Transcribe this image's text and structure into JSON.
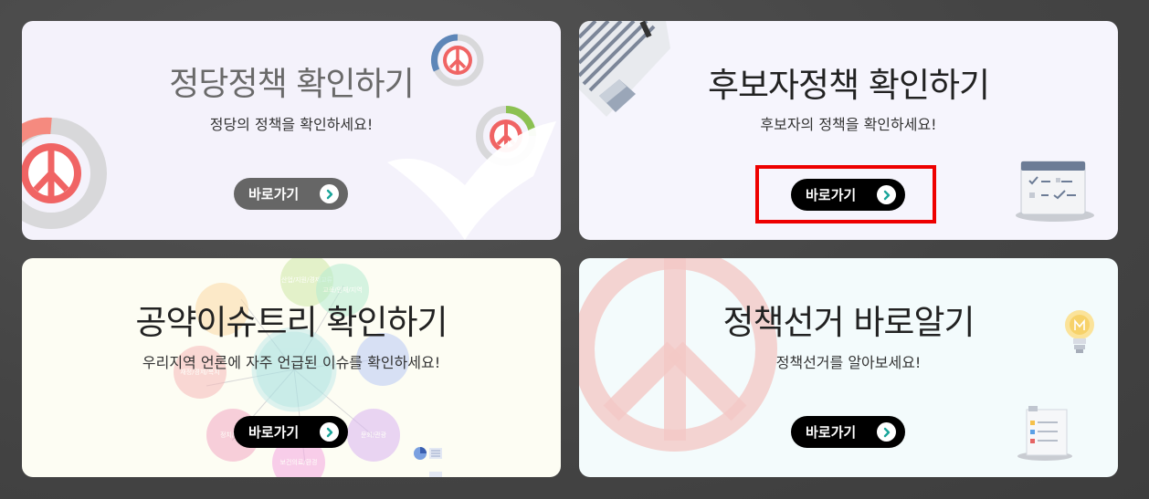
{
  "cards": [
    {
      "title": "정당정책 확인하기",
      "subtitle": "정당의 정책을 확인하세요!",
      "button_label": "바로가기"
    },
    {
      "title": "후보자정책 확인하기",
      "subtitle": "후보자의 정책을 확인하세요!",
      "button_label": "바로가기"
    },
    {
      "title": "공약이슈트리 확인하기",
      "subtitle": "우리지역 언론에 자주 언급된 이슈를 확인하세요!",
      "button_label": "바로가기"
    },
    {
      "title": "정책선거 바로알기",
      "subtitle": "정책선거를 알아보세요!",
      "button_label": "바로가기"
    }
  ],
  "issue_tree_bubbles": [
    "산업/지원/경제교류",
    "교육/인재/지역",
    "재정/경제/복지",
    "정치/행정",
    "문화/관광",
    "보건의료/환경"
  ],
  "colors": {
    "accent_red": "#ee0000",
    "button_dark": "#000000",
    "button_grey": "#666666",
    "arrow_teal": "#1aa59a",
    "peace_red": "#f06464"
  }
}
